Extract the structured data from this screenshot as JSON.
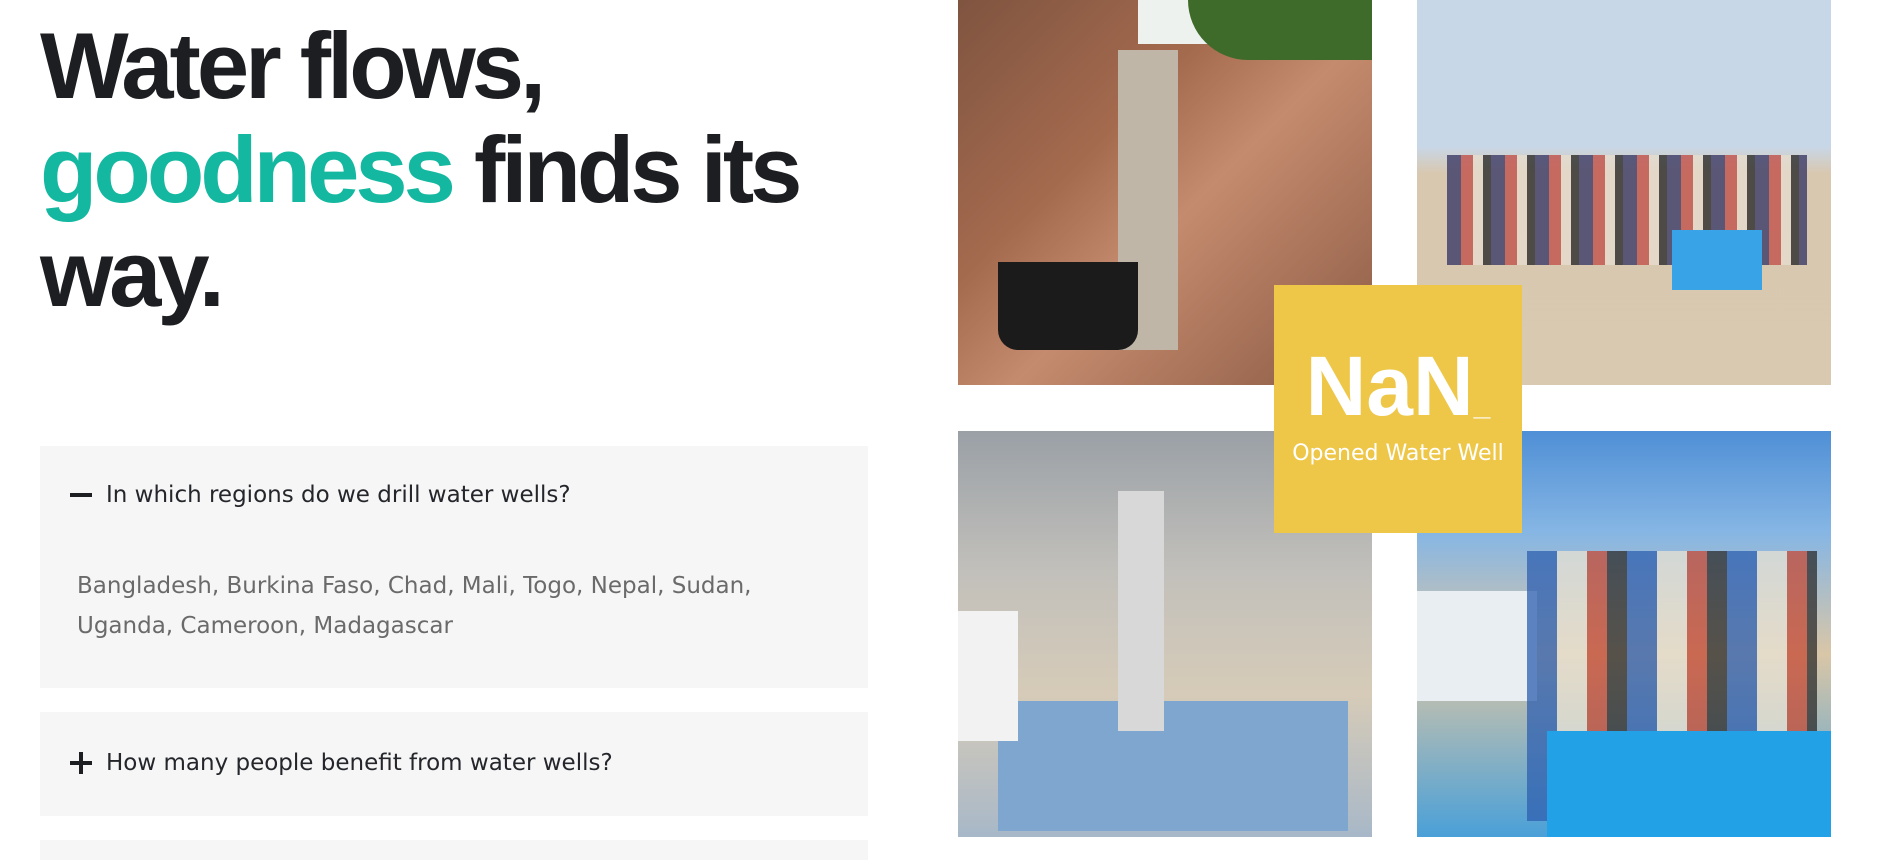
{
  "headline": {
    "line1": "Water flows,",
    "accent_word": "goodness",
    "line2_rest": " finds its",
    "line3": "way."
  },
  "faq": [
    {
      "question": "In which regions do we drill water wells?",
      "answer": "Bangladesh, Burkina Faso, Chad, Mali, Togo, Nepal, Sudan, Uganda, Cameroon, Madagascar",
      "expanded": true,
      "icon": "minus-icon"
    },
    {
      "question": "How many people benefit from water wells?",
      "expanded": false,
      "icon": "plus-icon"
    }
  ],
  "stat": {
    "value": "NaN",
    "suffix": "_",
    "label": "Opened Water Well"
  },
  "photos": [
    "well-photo-girls-at-hand-pump",
    "well-photo-community-gathering",
    "well-photo-men-at-pump",
    "well-photo-children-at-well"
  ],
  "colors": {
    "accent": "#14b8a0",
    "stat_bg": "#eec749",
    "faq_bg": "#f6f6f6",
    "heading": "#1c1e22"
  }
}
